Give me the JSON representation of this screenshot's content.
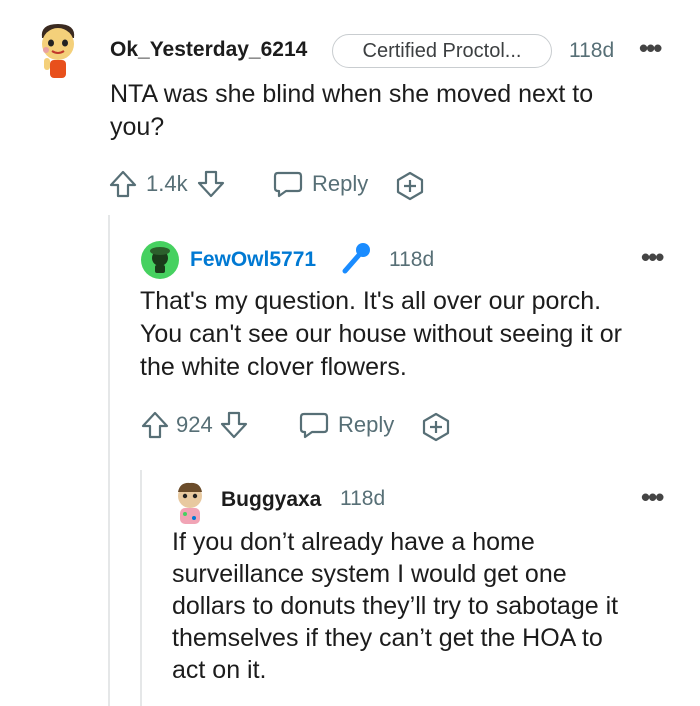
{
  "comments": [
    {
      "username": "Ok_Yesterday_6214",
      "flair": "Certified Proctol...",
      "age": "118d",
      "body": [
        "NTA was she blind when she moved next to",
        "you?"
      ],
      "votes": "1.4k",
      "reply_label": "Reply"
    },
    {
      "username": "FewOwl5771",
      "age": "118d",
      "body": [
        "That's my question. It's all over our porch.",
        "You can't see our house without seeing it or",
        "the white clover flowers."
      ],
      "votes": "924",
      "reply_label": "Reply"
    },
    {
      "username": "Buggyaxa",
      "age": "118d",
      "body": [
        "If you don’t already have a home",
        "surveillance system I would get one",
        "dollars to donuts they’ll try to sabotage it",
        "themselves if they can’t get the HOA to",
        "act on it."
      ]
    }
  ],
  "colors": {
    "op_name": "#1c1c1c",
    "fewowl_name": "#0079d3",
    "meta": "#576f76",
    "mic": "#1a8cff"
  }
}
